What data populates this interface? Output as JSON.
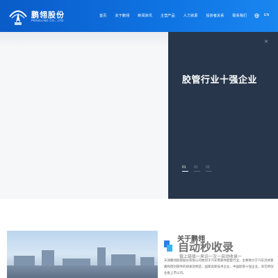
{
  "header": {
    "logo_cn": "鹏翎股份",
    "logo_en": "PENGLING CO., LTD.",
    "nav": [
      "首页",
      "关于鹏翎",
      "新闻资讯",
      "主营产品",
      "人力资源",
      "投资者关系",
      "联系我们"
    ],
    "lang": "EN",
    "globe_icon": "globe-icon"
  },
  "hero": {
    "title": "胶管行业十强企业",
    "slides": [
      "01",
      "02",
      "03"
    ],
    "active_slide": 0
  },
  "about": {
    "title": "关于鹏翎",
    "text": "天津鹏翎胶管股份有限公司始创于汽车零部件配套行业，主要致力于汽车流体管路和密封部件的研发及制造，国家高新技术企业、中国胶管十强企业，深交所创业板上市公司。",
    "watermark_title": "自动秒收录",
    "watermark_sub": "做上链接一来访一次一自动收录一"
  },
  "colors": {
    "header_blue": "#0f74e3",
    "panel_navy": "#27364a"
  }
}
